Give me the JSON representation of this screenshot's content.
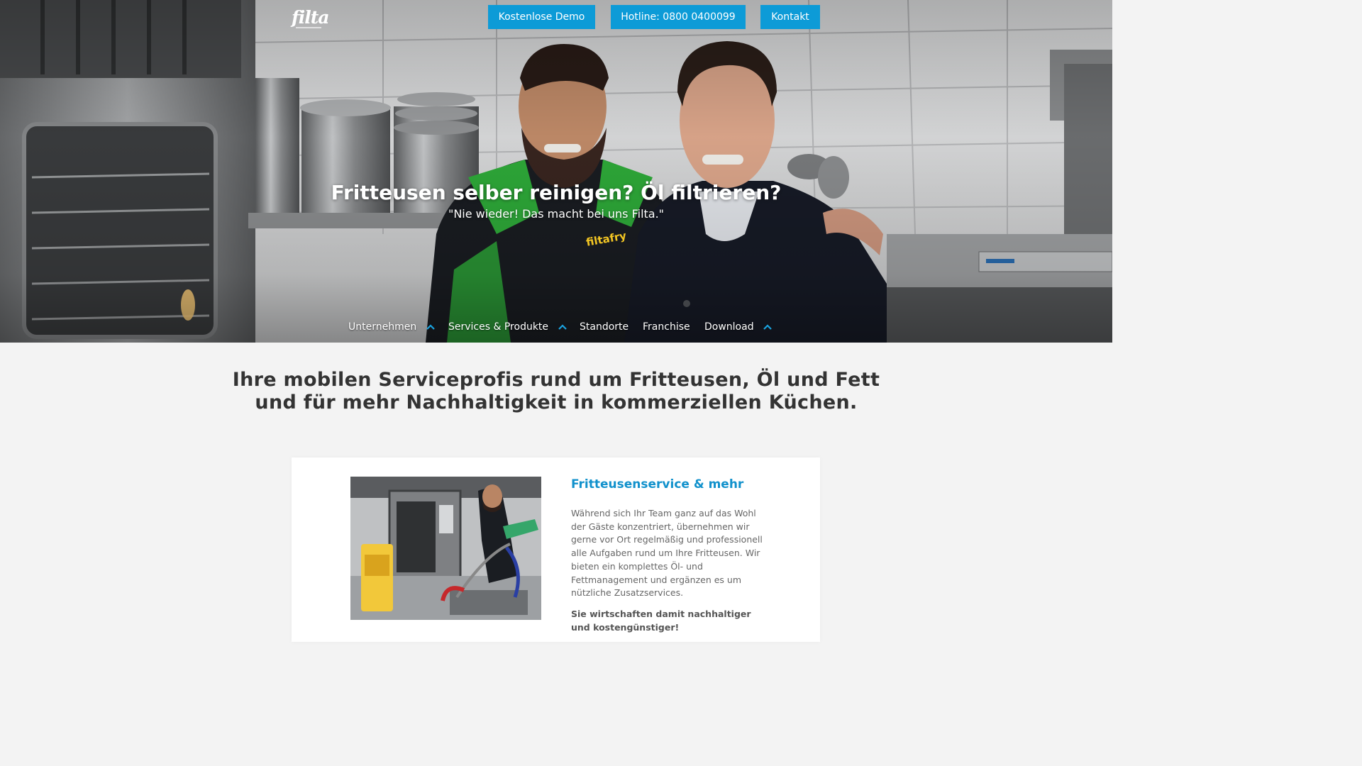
{
  "header": {
    "logo_text": "filta",
    "buttons": {
      "demo": "Kostenlose Demo",
      "hotline": "Hotline: 0800 0400099",
      "kontakt": "Kontakt"
    }
  },
  "hero": {
    "title": "Fritteusen selber reinigen? Öl filtrieren?",
    "subtitle": "\"Nie wieder! Das macht bei uns Filta.\"",
    "jacket_logo": "filtafry"
  },
  "nav": {
    "items": [
      {
        "label": "Unternehmen",
        "icon": "chevron-up-icon"
      },
      {
        "label": "Services & Produkte",
        "icon": "chevron-up-icon"
      },
      {
        "label": "Standorte"
      },
      {
        "label": "Franchise"
      },
      {
        "label": "Download",
        "icon": "chevron-up-icon"
      }
    ]
  },
  "intro": {
    "heading_line1": "Ihre mobilen Serviceprofis rund um Fritteusen, Öl und Fett",
    "heading_line2": "und für mehr Nachhaltigkeit in kommerziellen Küchen."
  },
  "card": {
    "title": "Fritteusenservice & mehr",
    "text": "Während sich Ihr Team ganz auf das Wohl der Gäste konzentriert, übernehmen wir gerne vor Ort regelmäßig und professionell alle Aufgaben rund um Ihre Fritteusen. Wir bieten ein komplettes Öl- und Fettmanagement und ergänzen es um nützliche Zusatzservices.",
    "bold_text": "Sie wirtschaften damit nachhaltiger und kostengünstiger!"
  },
  "colors": {
    "accent": "#0d9bd7",
    "title_blue": "#1191cc",
    "heading_text": "#333333",
    "page_bg": "#f3f3f3"
  }
}
